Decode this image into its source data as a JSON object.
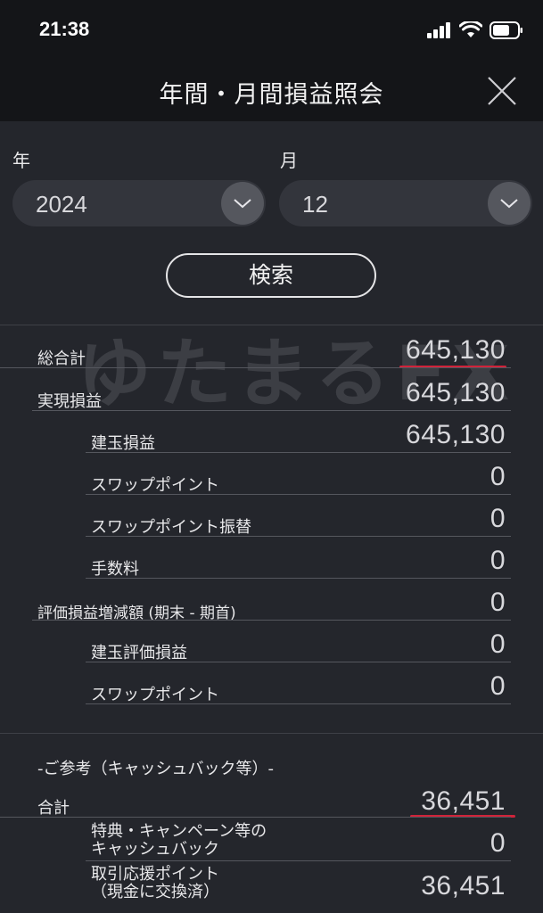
{
  "status": {
    "time": "21:38"
  },
  "header": {
    "title": "年間・月間損益照会"
  },
  "filters": {
    "year_label": "年",
    "month_label": "月",
    "year_value": "2024",
    "month_value": "12",
    "search_label": "検索"
  },
  "watermark": "ゆたまるFX",
  "summary": {
    "rows": [
      {
        "label": "総合計",
        "value": "645,130"
      },
      {
        "label": "実現損益",
        "value": "645,130"
      },
      {
        "label": "建玉損益",
        "value": "645,130"
      },
      {
        "label": "スワップポイント",
        "value": "0"
      },
      {
        "label": "スワップポイント振替",
        "value": "0"
      },
      {
        "label": "手数料",
        "value": "0"
      },
      {
        "label": "評価損益増減額 (期末 - 期首)",
        "value": "0"
      },
      {
        "label": "建玉評価損益",
        "value": "0"
      },
      {
        "label": "スワップポイント",
        "value": "0"
      }
    ]
  },
  "reference": {
    "title": "-ご参考（キャッシュバック等）-",
    "rows": [
      {
        "label": "合計",
        "value": "36,451"
      },
      {
        "label_line1": "特典・キャンペーン等の",
        "label_line2": "キャッシュバック",
        "value": "0"
      },
      {
        "label_line1": "取引応援ポイント",
        "label_line2": "（現金に交換済）",
        "value": "36,451"
      }
    ]
  },
  "colors": {
    "accent_underline": "#d0233a",
    "background": "#24262c",
    "bar": "#141518"
  }
}
